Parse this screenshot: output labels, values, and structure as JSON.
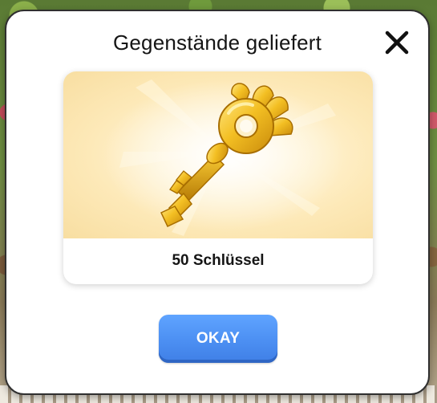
{
  "dialog": {
    "title": "Gegenstände geliefert",
    "close_icon": "close-icon",
    "reward": {
      "icon": "golden-key-icon",
      "label": "50 Schlüssel"
    },
    "okay_label": "OKAY"
  },
  "colors": {
    "accent_button": "#4c8ff2",
    "card_background": "#fde9b8",
    "key_gold": "#f0b51c"
  }
}
